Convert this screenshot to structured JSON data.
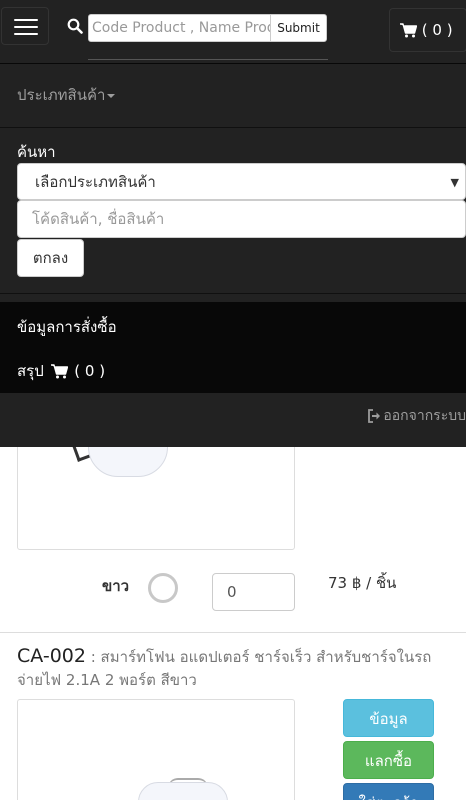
{
  "header": {
    "search_placeholder": "Code Product , Name Product",
    "submit_label": "Submit",
    "cart_count_label": "( 0 )"
  },
  "menu": {
    "category_label": "ประเภทสินค้า",
    "search_label": "ค้นหา",
    "category_select_value": "เลือกประเภทสินค้า",
    "keyword_placeholder": "โค้ดสินค้า, ชื่อสินค้า",
    "ok_label": "ตกลง",
    "order_info_label": "ข้อมูลการสั่งซื้อ",
    "summary_label": "สรุป",
    "summary_count": "( 0 )",
    "logout_label": "ออกจากระบบ"
  },
  "products": [
    {
      "color_label": "ขาว",
      "quantity": "0",
      "price": "73 ฿ / ชิ้น"
    },
    {
      "code": "CA-002",
      "description": " : สมาร์ทโฟน อแดปเตอร์ ชาร์จเร็ว สำหรับชาร์จในรถ จ่ายไฟ 2.1A 2 พอร์ต สีขาว",
      "info_button": "ข้อมูล",
      "buy_button": "แลกซื้อ",
      "cart_button": "ใส่ตะกร้า"
    }
  ],
  "icons": {
    "menu": "hamburger-icon",
    "search": "search-icon",
    "cart": "cart-icon",
    "logout": "logout-icon"
  },
  "colors": {
    "navbar": "#222222",
    "panel": "#080808",
    "info": "#5bc0de",
    "success": "#5cb85c",
    "primary": "#337ab7"
  }
}
